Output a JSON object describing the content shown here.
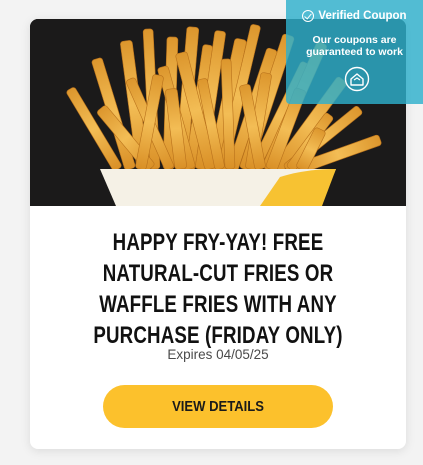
{
  "offer": {
    "title": "HAPPY FRY-YAY! FREE NATURAL-CUT FRIES OR WAFFLE FRIES WITH ANY PURCHASE (FRIDAY ONLY)",
    "expires": "Expires 04/05/25",
    "cta_label": "VIEW DETAILS"
  },
  "badge": {
    "title": "Verified Coupon",
    "subtitle_line1": "Our coupons are",
    "subtitle_line2": "guaranteed to work",
    "icon": "house-shield-icon"
  },
  "image": {
    "subject": "fries-photo"
  },
  "colors": {
    "accent": "#fcc12c",
    "badge": "#2eb0cc",
    "photo_background": "#1b1a1a"
  }
}
